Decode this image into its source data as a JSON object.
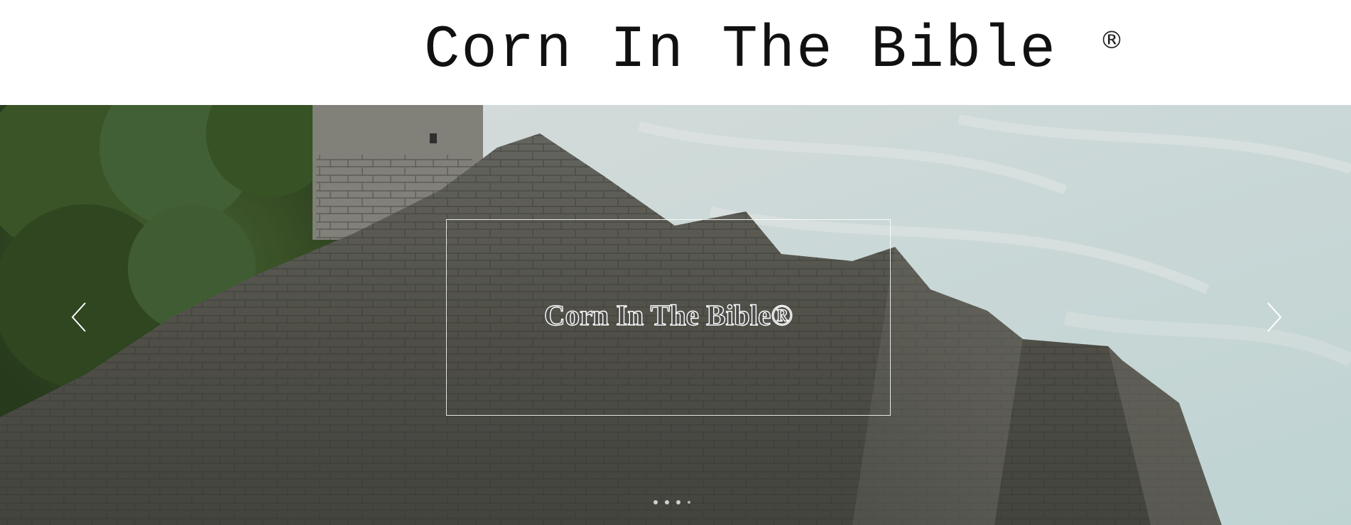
{
  "header": {
    "title": "Corn In The Bible",
    "registered_mark": "®"
  },
  "slideshow": {
    "caption": "Corn In The Bible®",
    "prev_icon": "chevron-left-icon",
    "next_icon": "chevron-right-icon",
    "slide_count": 4,
    "active_slide": 1
  },
  "colors": {
    "header_bg": "#ffffff",
    "title_text": "#111111",
    "caption_outline": "#ffffff"
  }
}
